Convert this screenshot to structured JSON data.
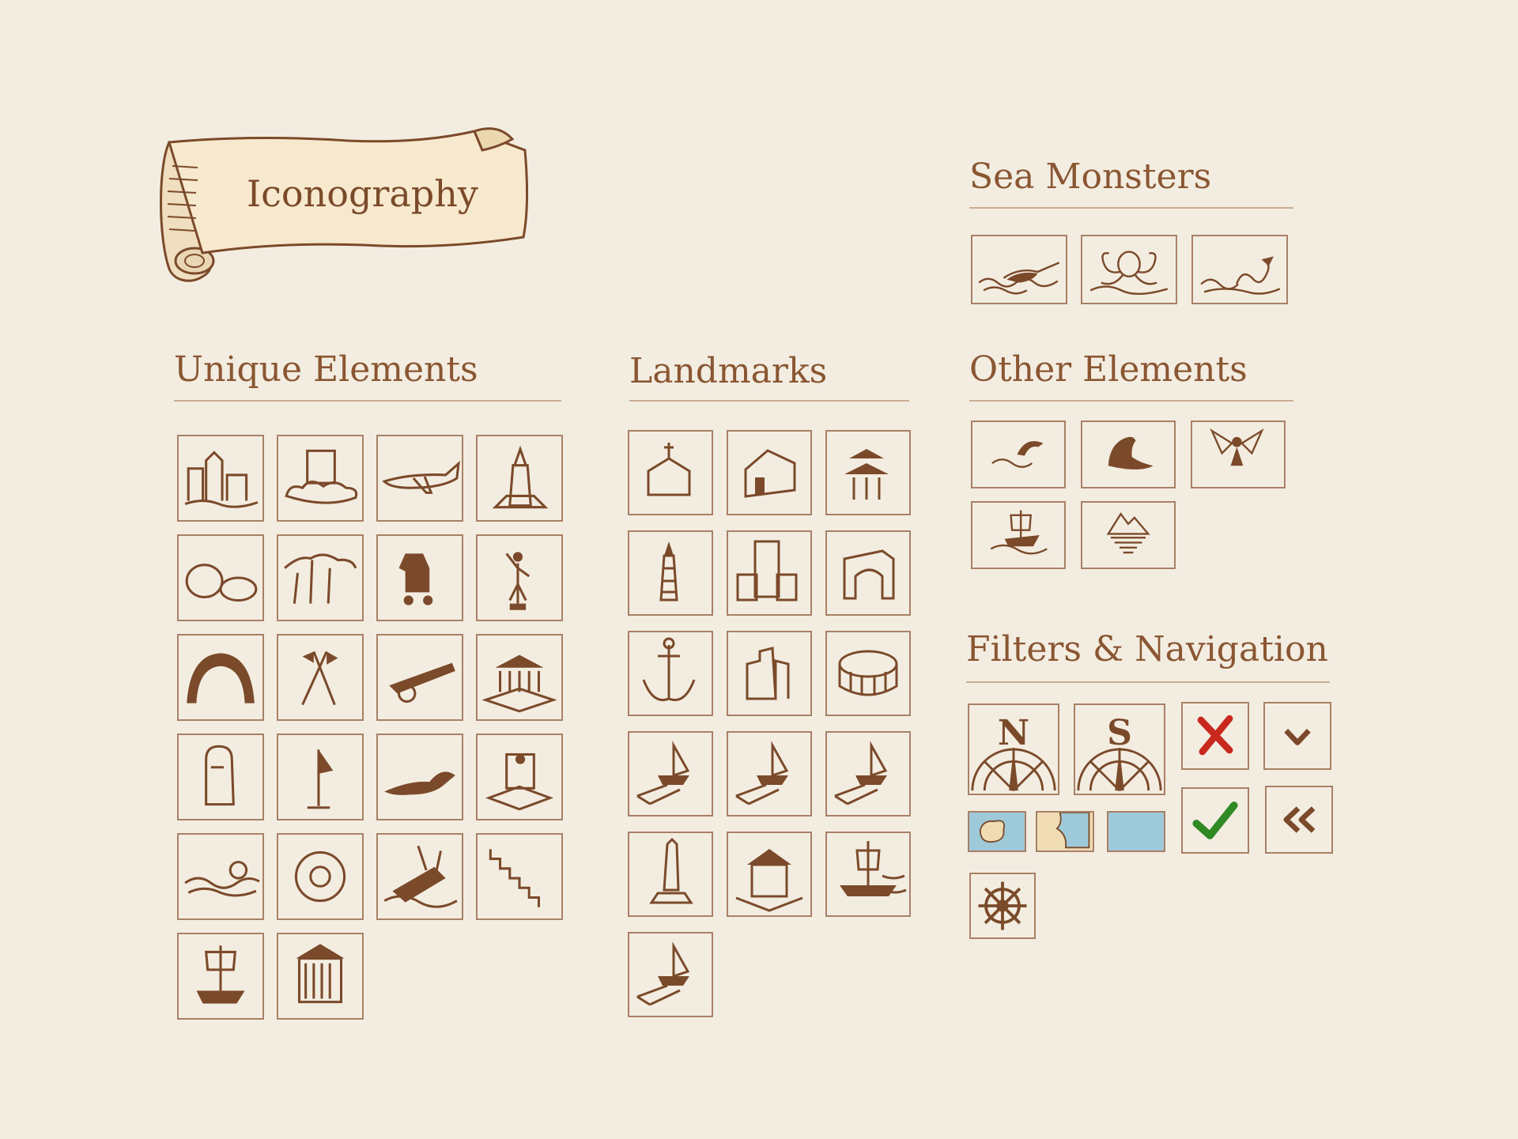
{
  "header": {
    "title": "Iconography"
  },
  "sections": {
    "sea_monsters": "Sea Monsters",
    "unique_elements": "Unique Elements",
    "landmarks": "Landmarks",
    "other_elements": "Other Elements",
    "filters_navigation": "Filters & Navigation"
  },
  "sea_monster_icons": [
    "narwhal-icon",
    "kraken-icon",
    "sea-serpent-icon"
  ],
  "unique_icons": [
    "harbor-town-icon",
    "cloud-temple-icon",
    "airplane-icon",
    "lighthouse-tower-icon",
    "stones-icon",
    "baobab-trees-icon",
    "trojan-horse-icon",
    "statue-icon",
    "arch-bridge-icon",
    "crossed-flags-icon",
    "cannon-icon",
    "temple-icon",
    "moai-icon",
    "flag-icon",
    "lizard-icon",
    "throne-statue-icon",
    "shipwreck-waves-icon",
    "stone-wheel-icon",
    "sinking-ship-icon",
    "zigzag-wall-icon",
    "galleon-icon",
    "mausoleum-icon"
  ],
  "landmark_icons": [
    "church-icon",
    "house-icon",
    "pagoda-icon",
    "lighthouse-icon",
    "castle-icon",
    "gate-icon",
    "anchor-icon",
    "ruin-icon",
    "colosseum-icon",
    "port-ship-icon",
    "port-ship-icon",
    "port-ship-icon",
    "obelisk-icon",
    "shrine-icon",
    "sailing-ship-icon",
    "port-ship-icon"
  ],
  "other_icons": [
    "dolphin-icon",
    "seal-icon",
    "demon-icon",
    "ship-waves-icon",
    "iceberg-icon"
  ],
  "filters": {
    "compass_north": "N",
    "compass_south": "S",
    "close_icon": "red-x-icon",
    "check_icon": "green-check-icon",
    "chevron_icon": "chevron-down-icon",
    "back_icon": "double-chevron-left-icon",
    "wheel_icon": "ship-wheel-icon",
    "swatches": [
      "island-swatch",
      "coast-swatch",
      "sea-swatch"
    ]
  },
  "colors": {
    "background": "#f3ede1",
    "ink": "#7b4a2a",
    "tile_border": "#a88066",
    "sea": "#9ec9d9",
    "land": "#efdcb4",
    "close_red": "#c8281e",
    "check_green": "#2f8a25"
  }
}
